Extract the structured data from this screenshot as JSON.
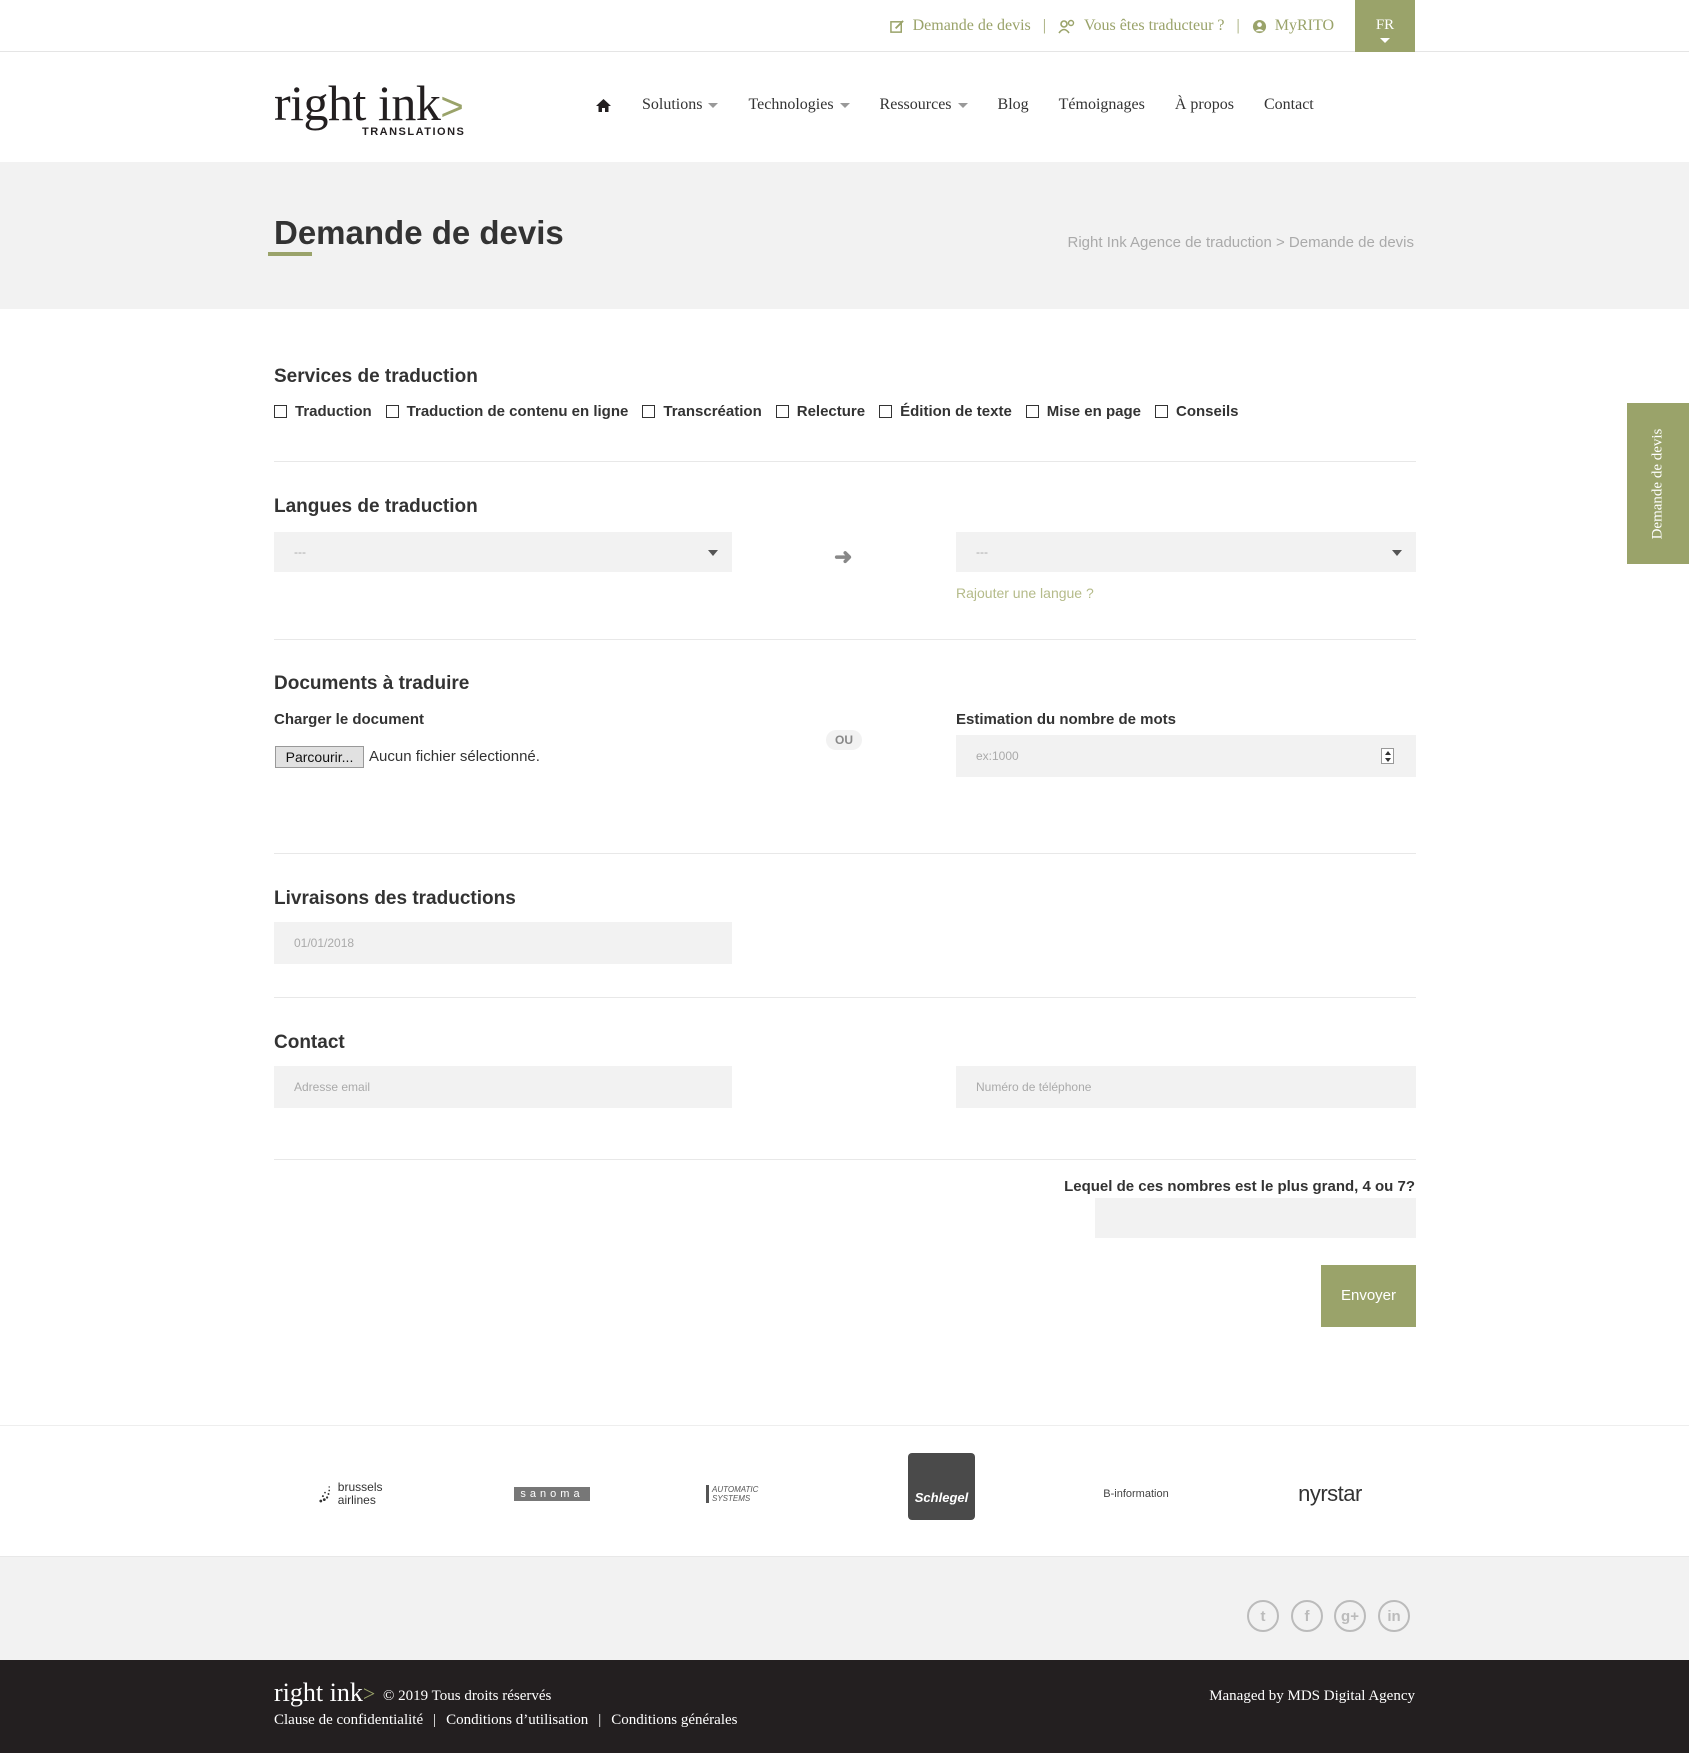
{
  "topbar": {
    "links": [
      {
        "label": "Demande de devis",
        "icon": "edit-icon"
      },
      {
        "label": "Vous êtes traducteur ?",
        "icon": "users-icon"
      },
      {
        "label": "MyRITO",
        "icon": "user-circle-icon"
      }
    ],
    "separator": "|",
    "language": "FR"
  },
  "logo": {
    "word": "right ink",
    "chevron": ">",
    "sub": "TRANSLATIONS"
  },
  "nav": {
    "items": [
      {
        "label": "Solutions",
        "dropdown": true
      },
      {
        "label": "Technologies",
        "dropdown": true
      },
      {
        "label": "Ressources",
        "dropdown": true
      },
      {
        "label": "Blog",
        "dropdown": false
      },
      {
        "label": "Témoignages",
        "dropdown": false
      },
      {
        "label": "À propos",
        "dropdown": false
      },
      {
        "label": "Contact",
        "dropdown": false
      }
    ]
  },
  "page": {
    "title": "Demande de devis",
    "breadcrumb": "Right Ink Agence de traduction > Demande de devis"
  },
  "sidetab": {
    "label": "Demande de devis"
  },
  "form": {
    "services": {
      "title": "Services de traduction",
      "options": [
        "Traduction",
        "Traduction de contenu en ligne",
        "Transcréation",
        "Relecture",
        "Édition de texte",
        "Mise en page",
        "Conseils"
      ]
    },
    "languages": {
      "title": "Langues de traduction",
      "source_value": "---",
      "target_value": "---",
      "add_language": "Rajouter une langue ?"
    },
    "documents": {
      "title": "Documents à traduire",
      "upload_label": "Charger le document",
      "browse_button": "Parcourir...",
      "no_file": "Aucun fichier sélectionné.",
      "or": "OU",
      "wordcount_label": "Estimation du nombre de mots",
      "wordcount_placeholder": "ex:1000"
    },
    "delivery": {
      "title": "Livraisons des traductions",
      "date_placeholder": "01/01/2018"
    },
    "contact": {
      "title": "Contact",
      "email_placeholder": "Adresse email",
      "phone_placeholder": "Numéro de téléphone"
    },
    "captcha_question": "Lequel de ces nombres est le plus grand, 4 ou 7?",
    "submit": "Envoyer"
  },
  "clients": [
    "brussels airlines",
    "sanoma",
    "AUTOMATIC SYSTEMS",
    "Schlegel",
    "B-information",
    "nyrstar"
  ],
  "social": [
    "twitter-icon",
    "facebook-icon",
    "google-plus-icon",
    "linkedin-icon"
  ],
  "footer": {
    "logo": "right ink",
    "copyright": "© 2019   Tous droits réservés",
    "links": [
      "Clause de confidentialité",
      "Conditions d’utilisation",
      "Conditions générales"
    ],
    "managed": "Managed by MDS Digital Agency"
  },
  "colors": {
    "accent": "#9aa36a",
    "band": "#f2f2f2",
    "footer": "#231f20"
  }
}
